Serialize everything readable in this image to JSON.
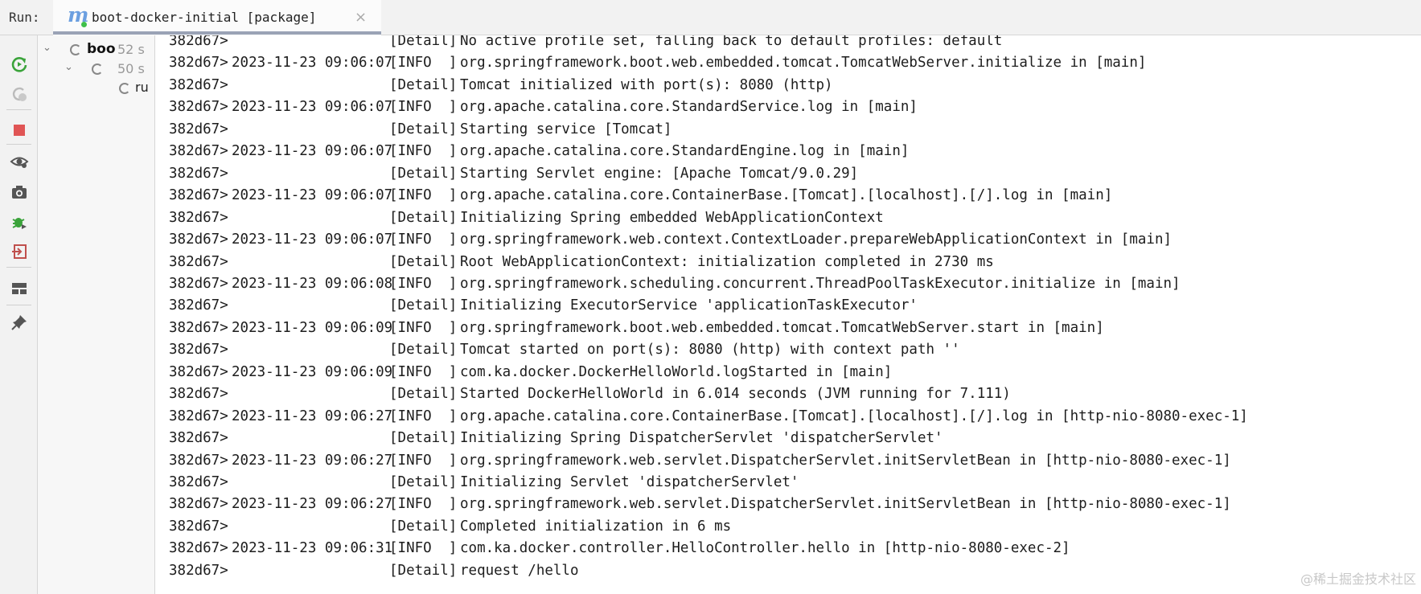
{
  "run_bar": {
    "label": "Run:",
    "tab_title": "boot-docker-initial [package]",
    "tab_icon": "maven-m-icon",
    "close_glyph": "×"
  },
  "tree": {
    "root": {
      "name": "boo",
      "time": "52 s"
    },
    "child": {
      "time": "50 s"
    },
    "leaf": {
      "name": "ru"
    }
  },
  "console": {
    "lines": [
      {
        "id": "382d67>",
        "timestamp": "",
        "level": "[Detail]",
        "message": "No active profile set, falling back to default profiles: default"
      },
      {
        "id": "382d67>",
        "timestamp": "2023-11-23 09:06:07",
        "level": "[INFO  ]",
        "message": "org.springframework.boot.web.embedded.tomcat.TomcatWebServer.initialize in [main]"
      },
      {
        "id": "382d67>",
        "timestamp": "",
        "level": "[Detail]",
        "message": "Tomcat initialized with port(s): 8080 (http)"
      },
      {
        "id": "382d67>",
        "timestamp": "2023-11-23 09:06:07",
        "level": "[INFO  ]",
        "message": "org.apache.catalina.core.StandardService.log in [main]"
      },
      {
        "id": "382d67>",
        "timestamp": "",
        "level": "[Detail]",
        "message": "Starting service [Tomcat]"
      },
      {
        "id": "382d67>",
        "timestamp": "2023-11-23 09:06:07",
        "level": "[INFO  ]",
        "message": "org.apache.catalina.core.StandardEngine.log in [main]"
      },
      {
        "id": "382d67>",
        "timestamp": "",
        "level": "[Detail]",
        "message": "Starting Servlet engine: [Apache Tomcat/9.0.29]"
      },
      {
        "id": "382d67>",
        "timestamp": "2023-11-23 09:06:07",
        "level": "[INFO  ]",
        "message": "org.apache.catalina.core.ContainerBase.[Tomcat].[localhost].[/].log in [main]"
      },
      {
        "id": "382d67>",
        "timestamp": "",
        "level": "[Detail]",
        "message": "Initializing Spring embedded WebApplicationContext"
      },
      {
        "id": "382d67>",
        "timestamp": "2023-11-23 09:06:07",
        "level": "[INFO  ]",
        "message": "org.springframework.web.context.ContextLoader.prepareWebApplicationContext in [main]"
      },
      {
        "id": "382d67>",
        "timestamp": "",
        "level": "[Detail]",
        "message": "Root WebApplicationContext: initialization completed in 2730 ms"
      },
      {
        "id": "382d67>",
        "timestamp": "2023-11-23 09:06:08",
        "level": "[INFO  ]",
        "message": "org.springframework.scheduling.concurrent.ThreadPoolTaskExecutor.initialize in [main]"
      },
      {
        "id": "382d67>",
        "timestamp": "",
        "level": "[Detail]",
        "message": "Initializing ExecutorService 'applicationTaskExecutor'"
      },
      {
        "id": "382d67>",
        "timestamp": "2023-11-23 09:06:09",
        "level": "[INFO  ]",
        "message": "org.springframework.boot.web.embedded.tomcat.TomcatWebServer.start in [main]"
      },
      {
        "id": "382d67>",
        "timestamp": "",
        "level": "[Detail]",
        "message": "Tomcat started on port(s): 8080 (http) with context path ''"
      },
      {
        "id": "382d67>",
        "timestamp": "2023-11-23 09:06:09",
        "level": "[INFO  ]",
        "message": "com.ka.docker.DockerHelloWorld.logStarted in [main]"
      },
      {
        "id": "382d67>",
        "timestamp": "",
        "level": "[Detail]",
        "message": "Started DockerHelloWorld in 6.014 seconds (JVM running for 7.111)"
      },
      {
        "id": "382d67>",
        "timestamp": "2023-11-23 09:06:27",
        "level": "[INFO  ]",
        "message": "org.apache.catalina.core.ContainerBase.[Tomcat].[localhost].[/].log in [http-nio-8080-exec-1]"
      },
      {
        "id": "382d67>",
        "timestamp": "",
        "level": "[Detail]",
        "message": "Initializing Spring DispatcherServlet 'dispatcherServlet'"
      },
      {
        "id": "382d67>",
        "timestamp": "2023-11-23 09:06:27",
        "level": "[INFO  ]",
        "message": "org.springframework.web.servlet.DispatcherServlet.initServletBean in [http-nio-8080-exec-1]"
      },
      {
        "id": "382d67>",
        "timestamp": "",
        "level": "[Detail]",
        "message": "Initializing Servlet 'dispatcherServlet'"
      },
      {
        "id": "382d67>",
        "timestamp": "2023-11-23 09:06:27",
        "level": "[INFO  ]",
        "message": "org.springframework.web.servlet.DispatcherServlet.initServletBean in [http-nio-8080-exec-1]"
      },
      {
        "id": "382d67>",
        "timestamp": "",
        "level": "[Detail]",
        "message": "Completed initialization in 6 ms"
      },
      {
        "id": "382d67>",
        "timestamp": "2023-11-23 09:06:31",
        "level": "[INFO  ]",
        "message": "com.ka.docker.controller.HelloController.hello in [http-nio-8080-exec-2]"
      },
      {
        "id": "382d67>",
        "timestamp": "",
        "level": "[Detail]",
        "message": "request /hello"
      }
    ]
  },
  "watermark": "@稀土掘金技术社区",
  "toolbar_icons": [
    "rerun-icon",
    "rerun-failed-icon",
    "stop-icon",
    "eye-icon",
    "camera-icon",
    "debug-icon",
    "exit-icon",
    "layout-icon",
    "pin-icon"
  ],
  "colors": {
    "rerun": "#3aa33a",
    "stop": "#e05555",
    "tab_underline": "#9aa3b6",
    "maven": "#6b9fe0"
  }
}
